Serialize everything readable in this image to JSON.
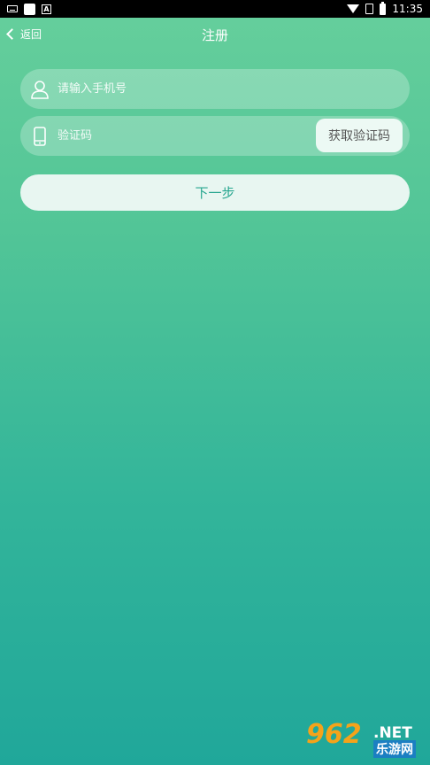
{
  "status_bar": {
    "time": "11:35"
  },
  "header": {
    "back_label": "返回",
    "title": "注册"
  },
  "form": {
    "phone_placeholder": "请输入手机号",
    "code_placeholder": "验证码",
    "get_code_label": "获取验证码",
    "next_label": "下一步"
  },
  "watermark": {
    "number": "962",
    "net": ".NET",
    "cn": "乐游网"
  },
  "colors": {
    "accent_text": "#27a68f",
    "gradient_top": "#66cf9c",
    "gradient_bottom": "#20a79a"
  }
}
